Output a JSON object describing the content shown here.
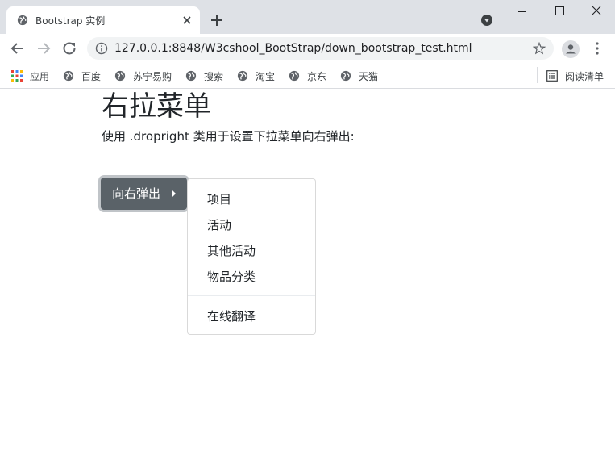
{
  "browser": {
    "tab_title": "Bootstrap 实例",
    "url": "127.0.0.1:8848/W3cshool_BootStrap/down_bootstrap_test.html",
    "bookmarks": [
      {
        "label": "应用",
        "icon": "apps-grid-icon"
      },
      {
        "label": "百度",
        "icon": "globe-icon"
      },
      {
        "label": "苏宁易购",
        "icon": "globe-icon"
      },
      {
        "label": "搜索",
        "icon": "globe-icon"
      },
      {
        "label": "淘宝",
        "icon": "globe-icon"
      },
      {
        "label": "京东",
        "icon": "globe-icon"
      },
      {
        "label": "天猫",
        "icon": "globe-icon"
      }
    ],
    "reading_list_label": "阅读清单"
  },
  "page": {
    "title": "右拉菜单",
    "description": "使用 .dropright 类用于设置下拉菜单向右弹出:",
    "dropdown": {
      "button_label": "向右弹出",
      "items": [
        "项目",
        "活动",
        "其他活动",
        "物品分类"
      ],
      "after_divider_items": [
        "在线翻译"
      ]
    }
  },
  "colors": {
    "button_bg": "#5a6268",
    "tabstrip_bg": "#dee1e6",
    "omnibox_bg": "#f1f3f4"
  }
}
